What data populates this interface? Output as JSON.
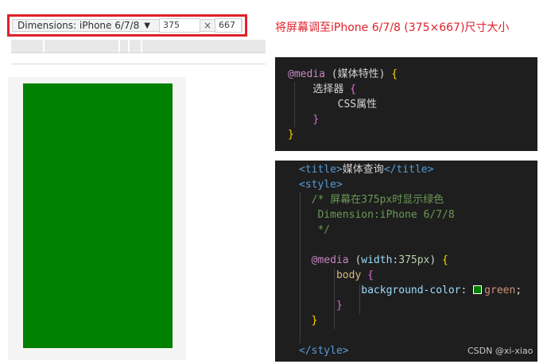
{
  "toolbar": {
    "device_label": "Dimensions: iPhone 6/7/8",
    "width_value": "375",
    "height_value": "667",
    "times_symbol": "×"
  },
  "caption": "将屏幕调至iPhone 6/7/8 (375×667)尺寸大小",
  "viewport": {
    "background_color": "#008000"
  },
  "code_syntax": {
    "line1_kw": "@media",
    "line1_rest": " (媒体特性) ",
    "line1_brace": "{",
    "line2_text": "选择器 ",
    "line2_brace": "{",
    "line3_text": "CSS属性",
    "line4_brace": "}",
    "line5_brace": "}"
  },
  "code_example": {
    "title_open": "<title>",
    "title_text": "媒体查询",
    "title_close": "</title>",
    "style_open": "<style>",
    "comment1": "/* 屏幕在375px时显示绿色",
    "comment2": "Dimension:iPhone 6/7/8",
    "comment3": "*/",
    "media_kw": "@media",
    "media_open": " (",
    "media_prop": "width",
    "media_colon": ":",
    "media_val": "375px",
    "media_close": ") ",
    "brace": "{",
    "selector": "body ",
    "decl_prop": "background-color",
    "decl_colon": ": ",
    "decl_value": "green",
    "decl_semi": ";",
    "close_brace": "}",
    "style_close": "</style>"
  },
  "watermark": "CSDN @xi-xiao"
}
